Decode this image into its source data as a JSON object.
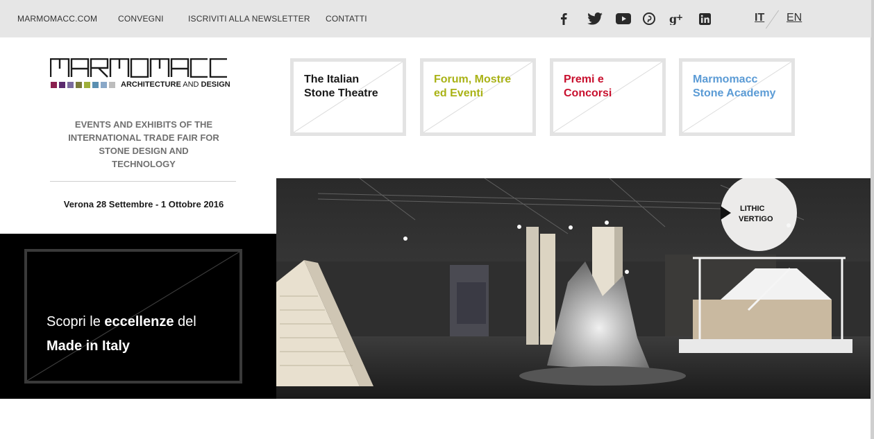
{
  "topnav": {
    "items": [
      "MARMOMACC.COM",
      "CONVEGNI",
      "ISCRIVITI ALLA NEWSLETTER",
      "CONTATTI"
    ]
  },
  "social": [
    "facebook-icon",
    "twitter-icon",
    "youtube-icon",
    "pinterest-icon",
    "google-plus-icon",
    "linkedin-icon"
  ],
  "languages": {
    "it": "IT",
    "en": "EN",
    "active": "IT"
  },
  "logo": {
    "wordmark": "MARMOMACC",
    "subtitle_bold": "ARCHITECTURE",
    "subtitle_and": "AND",
    "subtitle_bold2": "DESIGN",
    "square_colors": [
      "#8a1f4f",
      "#5b2a6e",
      "#7a6a9e",
      "#7a7a3a",
      "#9fb03a",
      "#5a8fb0",
      "#8aa8c8",
      "#bdbdbd"
    ]
  },
  "tagline": {
    "line1": "EVENTS AND EXHIBITS OF THE",
    "line2": "INTERNATIONAL TRADE FAIR FOR",
    "line3": "STONE DESIGN AND",
    "line4": "TECHNOLOGY"
  },
  "dates": "Verona 28 Settembre - 1 Ottobre 2016",
  "tiles": [
    {
      "line1": "The Italian",
      "line2": "Stone Theatre",
      "color": "#1a1a1a"
    },
    {
      "line1": "Forum, Mostre",
      "line2": "ed Eventi",
      "color": "#a9b215"
    },
    {
      "line1": "Premi e",
      "line2": "Concorsi",
      "color": "#c8102e"
    },
    {
      "line1": "Marmomacc",
      "line2": "Stone Academy",
      "color": "#5b9bd5"
    }
  ],
  "promo": {
    "pre": "Scopri le ",
    "highlight": "eccellenze",
    "post": " del",
    "line2": "Made in Italy"
  },
  "hero": {
    "sign_line1": "LITHIC",
    "sign_line2": "VERTIGO"
  }
}
